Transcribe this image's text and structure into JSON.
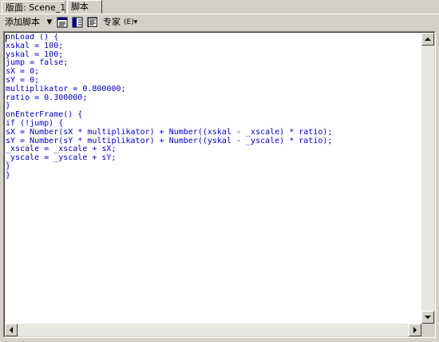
{
  "tabs": [
    {
      "label": "版面: Scene_1",
      "active": false
    },
    {
      "label": "脚本",
      "active": true
    }
  ],
  "toolbar": {
    "add_script_label": "添加脚本",
    "add_script_arrow": "▼",
    "expert_label": "专家",
    "expert_icon": "(E)▾",
    "icons": [
      "normal-mode-icon",
      "split-view-icon",
      "expert-mode-icon"
    ]
  },
  "editor": {
    "text_color": "#0000cc",
    "lines": [
      "onLoad () {",
      "xskal = 100;",
      "yskal = 100;",
      "jump = false;",
      "sX = 0;",
      "sY = 0;",
      "multiplikator = 0.800000;",
      "ratio = 0.300000;",
      "}",
      "onEnterFrame() {",
      "if (!jump) {",
      "sX = Number(sX * multiplikator) + Number((xskal - _xscale) * ratio);",
      "sY = Number(sY * multiplikator) + Number((yskal - _yscale) * ratio);",
      "_xscale = _xscale + sX;",
      "_yscale = _yscale + sY;",
      "}",
      "}"
    ]
  }
}
